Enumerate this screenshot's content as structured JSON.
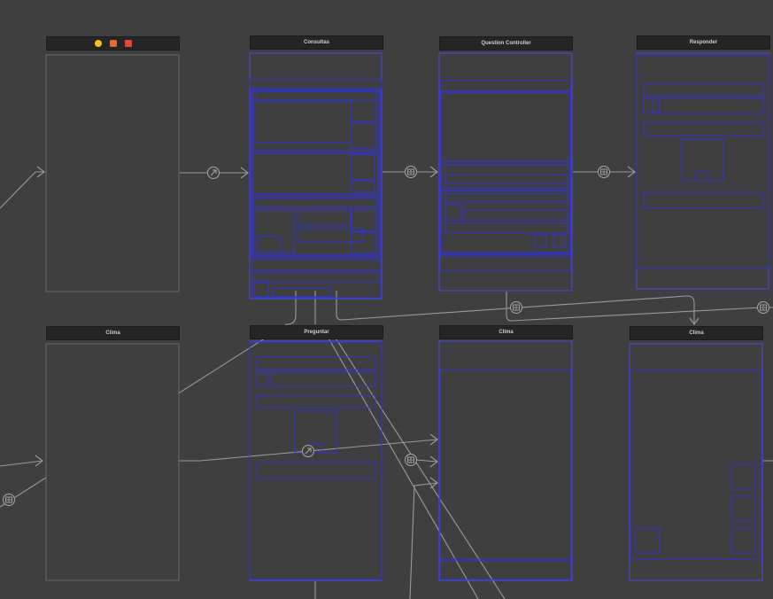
{
  "scenes": [
    {
      "id": "scene-view-controller",
      "title": "",
      "title_icons": [
        "first-responder-icon",
        "exit-icon",
        "view-controller-icon"
      ]
    },
    {
      "id": "scene-consultas",
      "title": "Consultas"
    },
    {
      "id": "scene-question-controller",
      "title": "Question Controller"
    },
    {
      "id": "scene-responder",
      "title": "Responder"
    },
    {
      "id": "scene-clima-1",
      "title": "Clima"
    },
    {
      "id": "scene-preguntar",
      "title": "Preguntar"
    },
    {
      "id": "scene-clima-2",
      "title": "Clima"
    },
    {
      "id": "scene-clima-3",
      "title": "Clima"
    }
  ],
  "segue_types": [
    "show-segue-icon",
    "push-segue-icon",
    "relationship-segue-icon"
  ],
  "colors": {
    "canvas": "#3f3f3f",
    "scene_border": "#6a6a6a",
    "view_outline": "#3333d6",
    "segue_line": "#9a9a9a",
    "title_bar": "#252525",
    "title_text": "#cfcfcf",
    "icon_yellow": "#f3c21d",
    "icon_orange": "#e36b3a",
    "icon_red": "#e2463f"
  }
}
